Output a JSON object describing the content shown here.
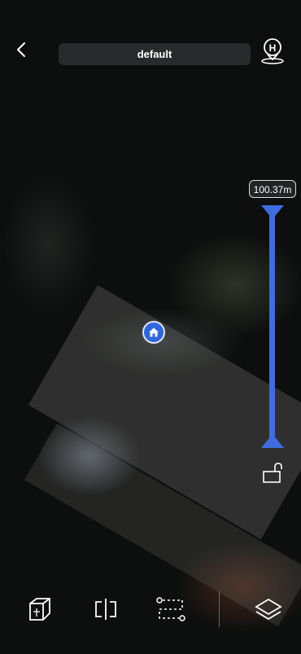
{
  "header": {
    "title": "default"
  },
  "height_slider": {
    "value_label": "100.37m",
    "accent_color": "#3f6ce0"
  },
  "icons": {
    "back": "chevron-left-icon",
    "home_point": "home-pin-icon",
    "lock": "unlock-icon",
    "home_marker": "home-icon",
    "toolbar": [
      "cube-icon",
      "compare-icon",
      "route-icon",
      "layers-icon"
    ]
  }
}
